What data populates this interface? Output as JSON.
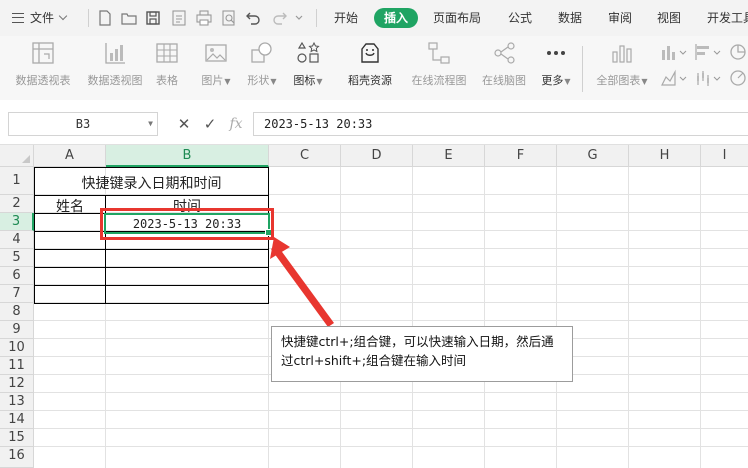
{
  "menubar": {
    "file_label": "文件",
    "tabs": [
      {
        "label": "开始",
        "active": false
      },
      {
        "label": "插入",
        "active": true
      },
      {
        "label": "页面布局",
        "active": false
      },
      {
        "label": "公式",
        "active": false
      },
      {
        "label": "数据",
        "active": false
      },
      {
        "label": "审阅",
        "active": false
      },
      {
        "label": "视图",
        "active": false
      },
      {
        "label": "开发工具",
        "active": false
      }
    ]
  },
  "ribbon": {
    "buttons": [
      {
        "label": "数据透视表",
        "icon": "pivot-table-icon"
      },
      {
        "label": "数据透视图",
        "icon": "pivot-chart-icon"
      },
      {
        "label": "表格",
        "icon": "table-icon"
      },
      {
        "label": "图片",
        "icon": "picture-icon",
        "dropdown": true
      },
      {
        "label": "形状",
        "icon": "shape-icon",
        "dropdown": true
      },
      {
        "label": "图标",
        "icon": "icons-icon",
        "dropdown": true
      },
      {
        "label": "稻壳资源",
        "icon": "docer-resource-icon"
      },
      {
        "label": "在线流程图",
        "icon": "flowchart-icon"
      },
      {
        "label": "在线脑图",
        "icon": "mindmap-icon"
      },
      {
        "label": "更多",
        "icon": "more-icon",
        "dropdown": true
      },
      {
        "label": "全部图表",
        "icon": "all-charts-icon",
        "dropdown": true
      }
    ]
  },
  "formula_bar": {
    "name_box": "B3",
    "formula": "2023-5-13 20:33"
  },
  "grid": {
    "columns": [
      "A",
      "B",
      "C",
      "D",
      "E",
      "F",
      "G",
      "H",
      "I"
    ],
    "selected_column": "B",
    "rows": [
      "1",
      "2",
      "3",
      "4",
      "5",
      "6",
      "7",
      "8",
      "9",
      "10",
      "11",
      "12",
      "13",
      "14",
      "15",
      "16"
    ],
    "selected_row": "3",
    "title_cell": "快捷键录入日期和时间",
    "header_name": "姓名",
    "header_time": "时间",
    "b3_value": "2023-5-13 20:33"
  },
  "annotation": {
    "text": "快捷键ctrl+;组合键，可以快速输入日期，然后通过ctrl+shift+;组合键在输入时间"
  },
  "colors": {
    "accent_green": "#1fa463",
    "highlight_red": "#e8362f"
  }
}
